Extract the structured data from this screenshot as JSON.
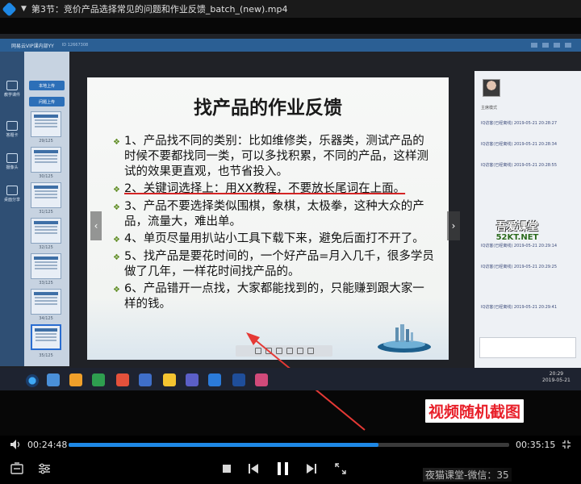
{
  "app": {
    "title": "第3节：竞价产品选择常见的问题和作业反馈_batch_(new).mp4"
  },
  "recorded_screen": {
    "software_title": "网易云VIP课内部YY",
    "room_id": "ID 12667308",
    "left_tools": [
      "教学课件",
      "答题卡",
      "摄像头",
      "桌面分享"
    ],
    "thumb_buttons": [
      "本地上传",
      "问题上传"
    ],
    "thumbnails": [
      "29/125",
      "30/125",
      "31/125",
      "32/125",
      "33/125",
      "34/125",
      "35/125"
    ],
    "chat_header": "主席模式",
    "chat_messages": [
      "IQ访客(已经离线) 2019-05-21 20:28:27",
      "IQ访客(已经离线) 2019-05-21 20:28:34",
      "IQ访客(已经离线) 2019-05-21 20:28:55",
      "IQ访客(已经离线) 2019-05-21 20:29:14",
      "IQ访客(已经离线) 2019-05-21 20:29:25",
      "IQ访客(已经离线) 2019-05-21 20:29:41"
    ],
    "taskbar_time": "20:29",
    "taskbar_date": "2019-05-21",
    "watermark_line1": "吾爱课堂",
    "watermark_line2": "52KT.NET"
  },
  "slide": {
    "title": "找产品的作业反馈",
    "bullets": [
      "1、产品找不同的类别：比如维修类，乐器类，测试产品的时候不要都找同一类，可以多找积累，不同的产品，这样测试的效果更直观，也节省投入。",
      "2、关键词选择上：用XX教程，不要放长尾词在上面。",
      "3、产品不要选择类似围棋，象棋，太极拳，这种大众的产品，流量大，难出单。",
      "4、单页尽量用扒站小工具下载下来，避免后面打不开了。",
      "5、找产品是要花时间的，一个好产品=月入几千，很多学员做了几年，一样花时间找产品的。",
      "6、产品错开一点找，大家都能找到的，只能赚到跟大家一样的钱。"
    ]
  },
  "overlay": {
    "random_screenshot_label": "视频随机截图"
  },
  "player": {
    "elapsed": "00:24:48",
    "total": "00:35:15",
    "progress": 0.704,
    "accent_color": "#1e88e5",
    "icons": [
      "volume-icon",
      "playlist-icon",
      "settings-icon",
      "stop-icon",
      "prev-icon",
      "pause-icon",
      "next-icon",
      "fullscreen-icon",
      "exit-fullscreen-icon"
    ]
  },
  "watermark_footer": "夜猫课堂-微信：35"
}
